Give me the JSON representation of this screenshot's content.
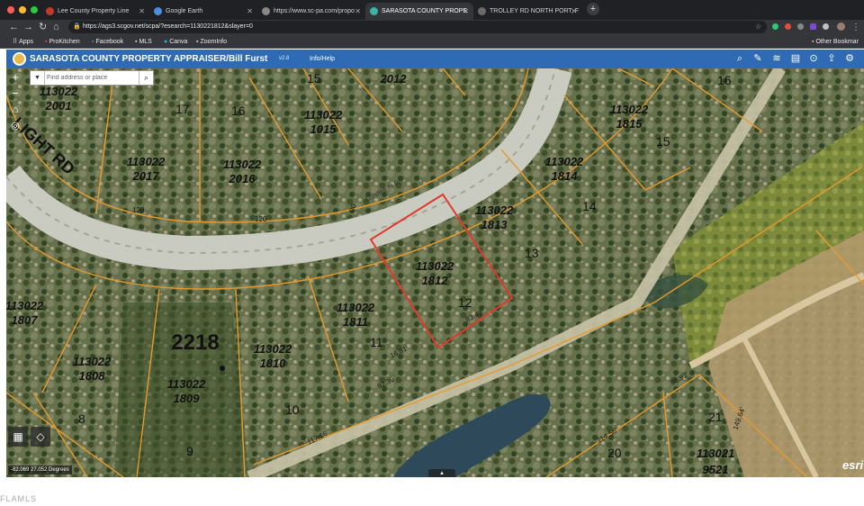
{
  "browser": {
    "tabs": [
      {
        "title": "Lee County Property Line",
        "active": false
      },
      {
        "title": "Google Earth",
        "active": false
      },
      {
        "title": "https://www.sc-pa.com/propo",
        "active": false
      },
      {
        "title": "SARASOTA COUNTY PROPE",
        "active": true
      },
      {
        "title": "TROLLEY RD NORTH PORT, F",
        "active": false
      }
    ],
    "url": "https://ags3.scgov.net/scpa/?esearch=1130221812&slayer=0",
    "bookmarks": [
      "Apps",
      "ProKitchen",
      "Facebook",
      "MLS",
      "Canva",
      "ZoomInfo"
    ],
    "other_bookmarks": "Other Bookmar"
  },
  "app": {
    "title": "SARASOTA COUNTY PROPERTY APPRAISER/Bill Furst",
    "version": "v2.8",
    "info_menu": "Info/Help",
    "header_color": "#2f6bb5"
  },
  "map": {
    "search_placeholder": "Find address or place",
    "coordinates": "-82.069 27.052 Degrees",
    "esri_logo": "esri",
    "road_label": "LIGHT RD",
    "road_label_small": "Candleli_ht Rd",
    "selection_color": "#e03a2c",
    "parcels": [
      {
        "id": "113022",
        "sub": "2001"
      },
      {
        "id": "113022",
        "sub": "2017"
      },
      {
        "id": "113022",
        "sub": "2016"
      },
      {
        "id": "113022",
        "sub": "1015"
      },
      {
        "id": "113022",
        "sub": "2012"
      },
      {
        "id": "113022",
        "sub": "1815"
      },
      {
        "id": "113022",
        "sub": "1814"
      },
      {
        "id": "113022",
        "sub": "1813"
      },
      {
        "id": "113022",
        "sub": "1812"
      },
      {
        "id": "113022",
        "sub": "1811"
      },
      {
        "id": "113022",
        "sub": "1810"
      },
      {
        "id": "113022",
        "sub": "1809"
      },
      {
        "id": "113022",
        "sub": "1808"
      },
      {
        "id": "113022",
        "sub": "1807"
      },
      {
        "id": "113021",
        "sub": "9521"
      }
    ],
    "block_label": "2218",
    "lot_numbers": [
      "16",
      "15",
      "14",
      "13",
      "12",
      "11",
      "10",
      "9",
      "8",
      "15",
      "17",
      "16",
      "21",
      "20"
    ],
    "dimensions": [
      "83.42'",
      "16.81'",
      "117.16'",
      "92.39'",
      "149.64'",
      "98.92'",
      "114.56'",
      "120",
      "120",
      "80"
    ]
  },
  "footer": {
    "watermark": "FLAMLS"
  }
}
